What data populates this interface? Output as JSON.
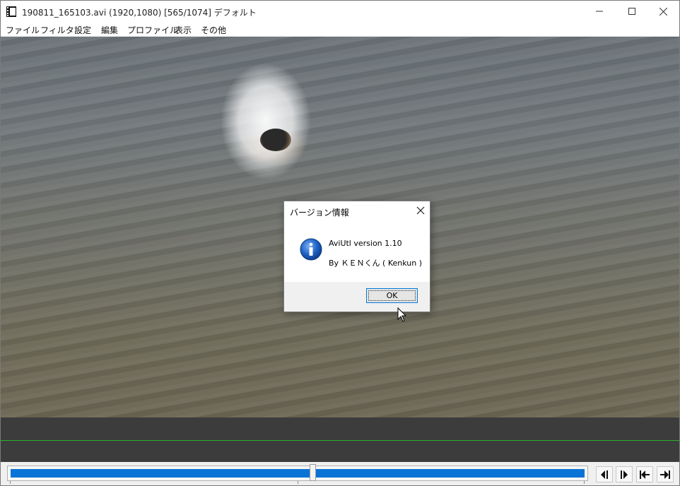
{
  "window": {
    "title": "190811_165103.avi (1920,1080)  [565/1074]  デフォルト"
  },
  "menu": [
    "ファイル",
    "フィルタ",
    "設定",
    "編集",
    "プロファイル",
    "表示",
    "その他"
  ],
  "seekbar": {
    "position_frame": 565,
    "total_frames": 1074
  },
  "nav_buttons": [
    "prev-frame-icon",
    "next-frame-icon",
    "first-frame-icon",
    "last-frame-icon"
  ],
  "dialog": {
    "title": "バージョン情報",
    "line1": "AviUtl version 1.10",
    "line2": "By ＫＥＮくん ( Kenkun )",
    "ok_label": "OK"
  },
  "colors": {
    "accent": "#0a74d6",
    "timeline_line": "#25b52b",
    "timeline_bg": "#3c3c3c"
  }
}
